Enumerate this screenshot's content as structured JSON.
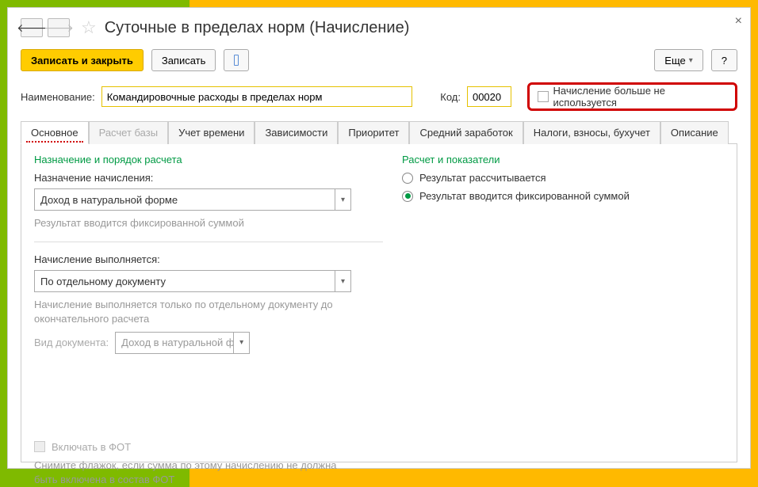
{
  "header": {
    "title": "Суточные в пределах норм (Начисление)"
  },
  "toolbar": {
    "save_close": "Записать и закрыть",
    "save": "Записать",
    "more": "Еще",
    "help": "?"
  },
  "fields": {
    "name_label": "Наименование:",
    "name_value": "Командировочные расходы в пределах норм",
    "code_label": "Код:",
    "code_value": "00020",
    "unused_label": "Начисление больше не используется"
  },
  "tabs": {
    "main": "Основное",
    "base": "Расчет базы",
    "time": "Учет времени",
    "deps": "Зависимости",
    "priority": "Приоритет",
    "avg": "Средний заработок",
    "taxes": "Налоги, взносы, бухучет",
    "desc": "Описание"
  },
  "left": {
    "section": "Назначение и порядок расчета",
    "purpose_label": "Назначение начисления:",
    "purpose_value": "Доход в натуральной форме",
    "purpose_hint": "Результат вводится фиксированной суммой",
    "executed_label": "Начисление выполняется:",
    "executed_value": "По отдельному документу",
    "executed_hint": "Начисление выполняется только по отдельному документу до окончательного расчета",
    "doc_label": "Вид документа:",
    "doc_value": "Доход в натуральной фор",
    "fot_label": "Включать в ФОТ",
    "fot_hint": "Снимите флажок, если сумма по этому начислению не должна быть включена в состав ФОТ"
  },
  "right": {
    "section": "Расчет и показатели",
    "radio1": "Результат рассчитывается",
    "radio2": "Результат вводится фиксированной суммой"
  }
}
